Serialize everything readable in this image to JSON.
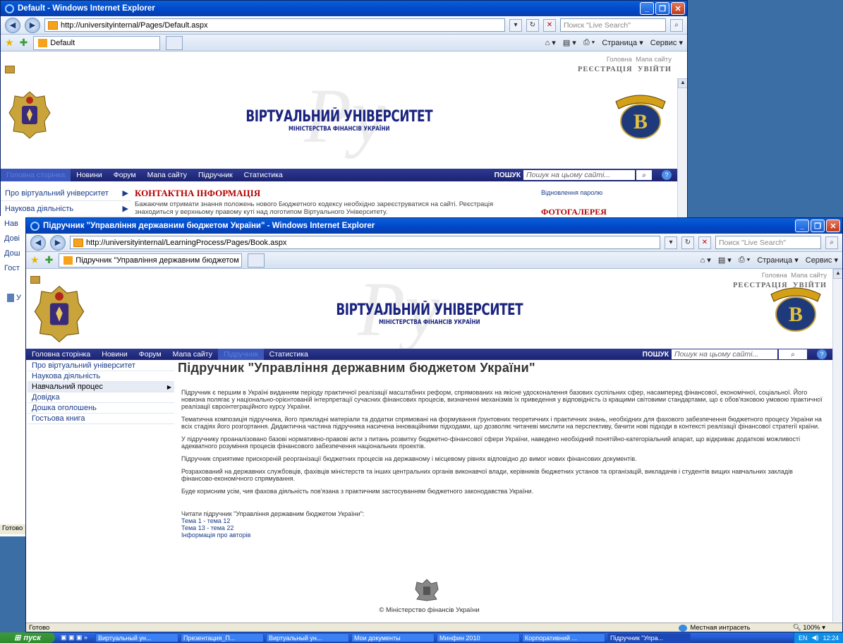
{
  "back_window": {
    "title": "Default - Windows Internet Explorer",
    "url": "http://universityinternal/Pages/Default.aspx",
    "live_search_placeholder": "Поиск \"Live Search\"",
    "tab_title": "Default",
    "cmd_page": "Страница",
    "cmd_service": "Сервис",
    "top_home": "Головна",
    "top_sitemap": "Мапа сайту",
    "top_register": "РЕЄСТРАЦІЯ",
    "top_login": "УВІЙТИ",
    "watermark": "Ру",
    "logo_main": "ВІРТУАЛЬНИЙ УНІВЕРСИТЕТ",
    "logo_sub": "МІНІСТЕРСТВА ФІНАНСІВ УКРАЇНИ",
    "nav": [
      "Головна сторінка",
      "Новини",
      "Форум",
      "Мапа сайту",
      "Підручник",
      "Статистика"
    ],
    "search_label": "ПОШУК",
    "search_placeholder": "Пошук на цьому сайті...",
    "left_items": [
      "Про віртуальний університет",
      "Наукова діяльність",
      "Нав",
      "Дові",
      "Дош",
      "Гост"
    ],
    "contact_heading": "КОНТАКТНА ІНФОРМАЦІЯ",
    "contact_text": "Бажаючим отримати знання положень нового Бюджетного кодексу необхідно зареєструватися  на сайті. Реєстрація знаходиться у верхньому правому куті над логотипом Віртуального Університету.",
    "password_link": "Відновлення паролю",
    "gallery_heading": "ФОТОГАЛЕРЕЯ",
    "left_fragment": "У",
    "status": "Готово"
  },
  "front_window": {
    "title": "Підручник \"Управління державним бюджетом України\" - Windows Internet Explorer",
    "url": "http://universityinternal/LearningProcess/Pages/Book.aspx",
    "live_search_placeholder": "Поиск \"Live Search\"",
    "tab_title": "Підручник \"Управління державним бюджетом Укр...",
    "cmd_page": "Страница",
    "cmd_service": "Сервис",
    "top_home": "Головна",
    "top_sitemap": "Мапа сайту",
    "top_register": "РЕЄСТРАЦІЯ",
    "top_login": "УВІЙТИ",
    "watermark": "Ру",
    "logo_main": "ВІРТУАЛЬНИЙ УНІВЕРСИТЕТ",
    "logo_sub": "МІНІСТЕРСТВА ФІНАНСІВ УКРАЇНИ",
    "nav": [
      "Головна сторінка",
      "Новини",
      "Форум",
      "Мапа сайту",
      "Підручник",
      "Статистика"
    ],
    "search_label": "ПОШУК",
    "search_placeholder": "Пошук на цьому сайті...",
    "left_items": [
      "Про віртуальний університет",
      "Наукова діяльність",
      "Навчальний процес",
      "Довідка",
      "Дошка оголошень",
      "Гостьова книга"
    ],
    "page_title": "Підручник \"Управління державним бюджетом України\"",
    "paragraphs": [
      "Підручник є першим в Україні виданням періоду практичної реалізації масштабних реформ, спрямованих на якісне удосконалення базових суспільних сфер, насамперед фінансової, економічної, соціальної. Його новизна полягає у національно-орієнтованій інтерпретації сучасних фінансових процесів, визначенні механізмів їх приведення у відповідність із кращими світовими стандартами, що є обов'язковою умовою практичної реалізації євроінтеграційного курсу України.",
      "Тематична композиція підручника, його прикладні матеріали та додатки спрямовані на формування ґрунтовних теоретичних і практичних знань, необхідних для фахового забезпечення бюджетного процесу України на всіх стадіях його розгортання. Дидактична частина підручника насичена інноваційними підходами, що дозволяє читачеві мислити на перспективу, бачити нові підходи в контексті реалізації фінансової стратегії країни.",
      "У підручнику проаналізовано базові нормативно-правові акти з питань розвитку бюджетно-фінансової сфери України, наведено необхідний понятійно-категоріальний апарат, що відкриває додаткові можливості адекватного розуміння процесів фінансового забезпечення національних проектів.",
      "Підручник сприятиме прискореній реорганізації бюджетних процесів на державному і місцевому рівнях відповідно до вимог нових фінансових документів.",
      "Розрахований на державних службовців, фахівців міністерств та інших центральних органів виконавчої влади, керівників бюджетних установ та організацій, викладачів і студентів вищих навчальних закладів фінансово-економічного спрямування.",
      "Буде корисним усім, чия фахова діяльність пов'язана з практичним застосуванням бюджетного законодавства України."
    ],
    "read_label": "Читати підручник \"Управління державним бюджетом України\":",
    "links": [
      "Тема 1 - тема 12",
      "Тема 13 - тема 22",
      "Інформація про авторів"
    ],
    "footer": "© Міністерство фінансів України",
    "status": "Готово",
    "zone": "Местная интрасеть",
    "zoom": "100%"
  },
  "taskbar": {
    "start": "пуск",
    "tasks": [
      "Виртуальный ун...",
      "Презентация_П...",
      "Виртуальный ун...",
      "Мои документы",
      "Минфин 2010",
      "Корпоративний ...",
      "Підручник \"Упра..."
    ],
    "lang": "EN",
    "clock": "12:24"
  },
  "colors": {
    "navy": "#1b2370",
    "link": "#1a3b8a",
    "heading_red": "#b30000",
    "titlebar": "#0046c8"
  }
}
